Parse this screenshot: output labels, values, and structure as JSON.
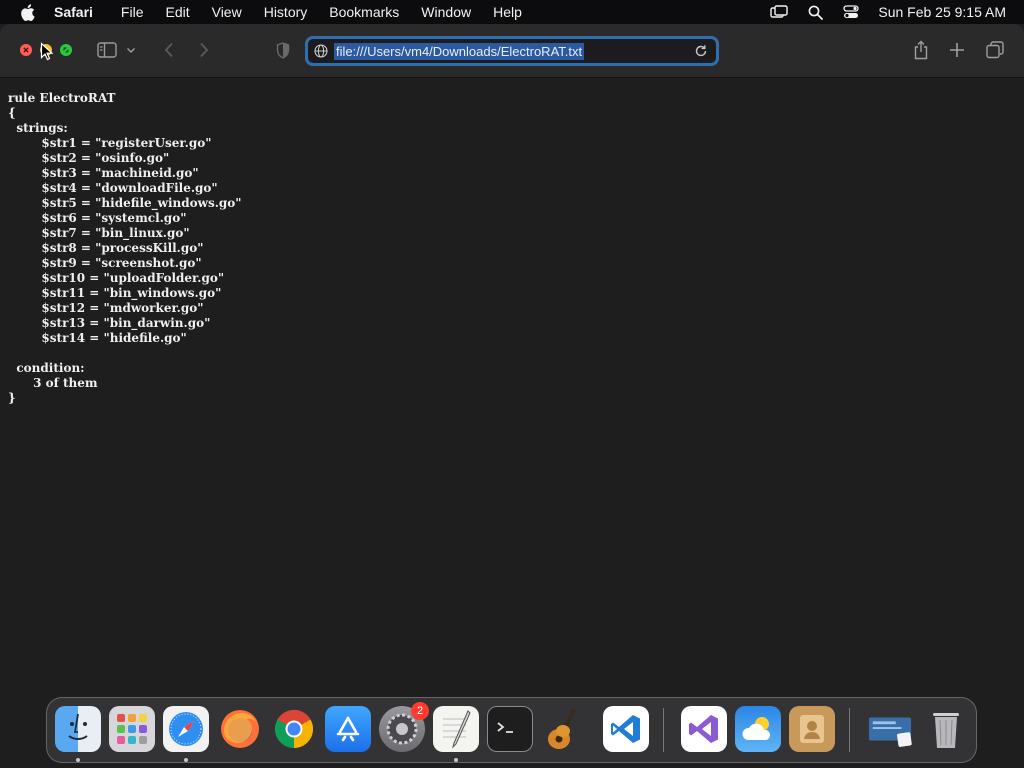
{
  "menubar": {
    "app_name": "Safari",
    "items": [
      "File",
      "Edit",
      "View",
      "History",
      "Bookmarks",
      "Window",
      "Help"
    ],
    "clock": "Sun Feb 25  9:15 AM",
    "icons": [
      "apple-icon",
      "screen-mirroring-icon",
      "spotlight-search-icon",
      "control-center-icon"
    ]
  },
  "browser": {
    "url": "file:///Users/vm4/Downloads/ElectroRAT.txt",
    "document_text": "rule ElectroRAT\n{\n  strings:\n        $str1 = \"registerUser.go\"\n        $str2 = \"osinfo.go\"\n        $str3 = \"machineid.go\"\n        $str4 = \"downloadFile.go\"\n        $str5 = \"hidefile_windows.go\"\n        $str6 = \"systemcl.go\"\n        $str7 = \"bin_linux.go\"\n        $str8 = \"processKill.go\"\n        $str9 = \"screenshot.go\"\n        $str10 = \"uploadFolder.go\"\n        $str11 = \"bin_windows.go\"\n        $str12 = \"mdworker.go\"\n        $str13 = \"bin_darwin.go\"\n        $str14 = \"hidefile.go\"\n\n  condition:\n      3 of them\n}"
  },
  "dock": {
    "apps": [
      {
        "name": "Finder",
        "icon": "finder-icon",
        "running": true
      },
      {
        "name": "Launchpad",
        "icon": "launchpad-icon",
        "running": false
      },
      {
        "name": "Safari",
        "icon": "safari-icon",
        "running": true
      },
      {
        "name": "Firefox",
        "icon": "firefox-icon",
        "running": false
      },
      {
        "name": "Chrome",
        "icon": "chrome-icon",
        "running": false
      },
      {
        "name": "App Store",
        "icon": "app-store-icon",
        "running": false
      },
      {
        "name": "System Settings",
        "icon": "system-settings-icon",
        "running": false,
        "badge": "2"
      },
      {
        "name": "TextEdit",
        "icon": "textedit-icon",
        "running": true
      },
      {
        "name": "Terminal",
        "icon": "terminal-icon",
        "running": false
      },
      {
        "name": "GarageBand",
        "icon": "garageband-icon",
        "running": false
      },
      {
        "name": "Visual Studio Code",
        "icon": "vscode-icon",
        "running": false
      },
      {
        "name": "Visual Studio",
        "icon": "visual-studio-icon",
        "running": false
      },
      {
        "name": "Weather",
        "icon": "weather-icon",
        "running": false
      },
      {
        "name": "Contacts",
        "icon": "contacts-icon",
        "running": false
      },
      {
        "name": "Downloads",
        "icon": "downloads-stack-icon",
        "running": false
      },
      {
        "name": "Trash",
        "icon": "trash-icon",
        "running": false
      }
    ]
  }
}
